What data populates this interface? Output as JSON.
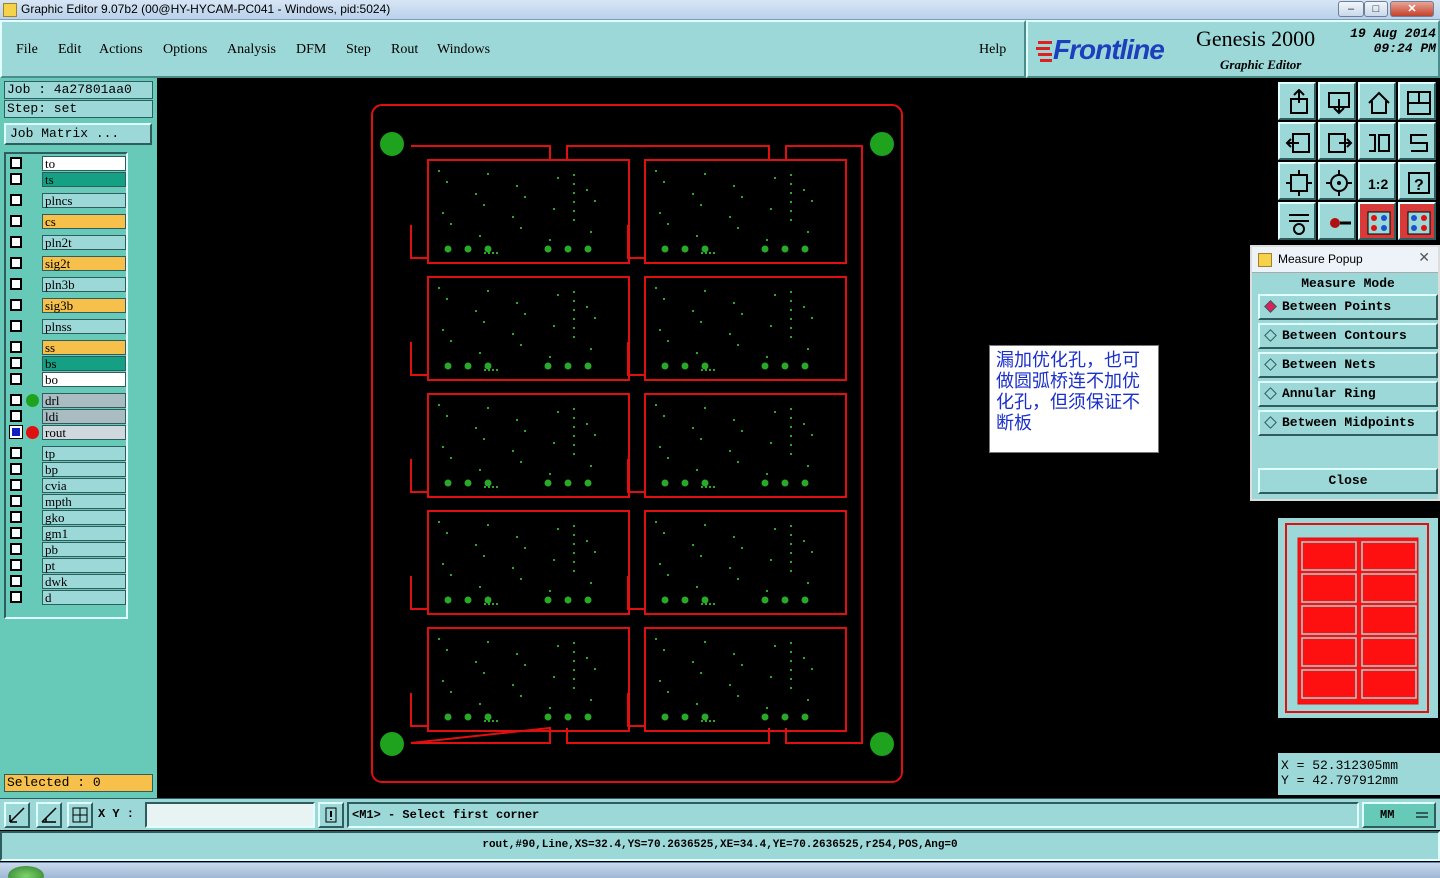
{
  "window": {
    "title": "Graphic Editor 9.07b2 (00@HY-HYCAM-PC041 - Windows, pid:5024)",
    "minimize": "–",
    "maximize": "□",
    "close": "✕"
  },
  "menu": [
    "File",
    "Edit",
    "Actions",
    "Options",
    "Analysis",
    "DFM",
    "Step",
    "Rout",
    "Windows"
  ],
  "help": "Help",
  "brand": {
    "logo": "Frontline",
    "product": "Genesis 2000",
    "subtitle": "Graphic Editor",
    "date": "19 Aug 2014",
    "time": "09:24 PM"
  },
  "job": {
    "job_line": "Job : 4a27801aa0",
    "step_line": "Step: set",
    "matrix_button": "Job Matrix ..."
  },
  "layers": [
    {
      "name": "to",
      "color": "#ffffff"
    },
    {
      "name": "ts",
      "color": "#16a083"
    },
    {
      "name": "plncs",
      "color": "#9cd8d8"
    },
    {
      "name": "cs",
      "color": "#f6c04a"
    },
    {
      "name": "pln2t",
      "color": "#9cd8d8"
    },
    {
      "name": "sig2t",
      "color": "#f6c04a"
    },
    {
      "name": "pln3b",
      "color": "#9cd8d8"
    },
    {
      "name": "sig3b",
      "color": "#f6c04a"
    },
    {
      "name": "plnss",
      "color": "#9cd8d8"
    },
    {
      "name": "ss",
      "color": "#f6c04a"
    },
    {
      "name": "bs",
      "color": "#16a083"
    },
    {
      "name": "bo",
      "color": "#ffffff"
    },
    {
      "name": "drl",
      "color": "#a9bcc2",
      "dot": "#1fa31f"
    },
    {
      "name": "ldi",
      "color": "#a9bcc2"
    },
    {
      "name": "rout",
      "color": "#cfd8dc",
      "dot": "#e01010",
      "active": true
    },
    {
      "name": "tp",
      "color": "#9cd8d8"
    },
    {
      "name": "bp",
      "color": "#9cd8d8"
    },
    {
      "name": "cvia",
      "color": "#9cd8d8"
    },
    {
      "name": "mpth",
      "color": "#9cd8d8"
    },
    {
      "name": "gko",
      "color": "#9cd8d8"
    },
    {
      "name": "gm1",
      "color": "#9cd8d8"
    },
    {
      "name": "pb",
      "color": "#9cd8d8"
    },
    {
      "name": "pt",
      "color": "#9cd8d8"
    },
    {
      "name": "dwk",
      "color": "#9cd8d8"
    },
    {
      "name": "d",
      "color": "#9cd8d8"
    }
  ],
  "selected": "Selected : 0",
  "note": "漏加优化孔，也可做圆弧桥连不加优化孔，但须保证不断板",
  "measure": {
    "title": "Measure Popup",
    "mode_label": "Measure Mode",
    "options": [
      "Between Points",
      "Between Contours",
      "Between Nets",
      "Annular Ring",
      "Between Midpoints"
    ],
    "selected_index": 0,
    "close": "Close"
  },
  "coords": {
    "x": "X = 52.312305mm",
    "y": "Y = 42.797912mm"
  },
  "bottom": {
    "xy_label": "X Y :",
    "xy_value": "",
    "prompt": "<M1> - Select first corner",
    "units": "MM"
  },
  "status_line": "rout,#90,Line,XS=32.4,YS=70.2636525,XE=34.4,YE=70.2636525,r254,POS,Ang=0",
  "colors": {
    "panel": "#9cd8d8",
    "panel_dark": "#67c9b8",
    "rout_outline": "#e01010",
    "fiducial": "#1fa31f",
    "pad": "#2aa82a"
  },
  "tools": [
    "open-icon",
    "save-icon",
    "home-icon",
    "window-icon",
    "left-icon",
    "right-icon",
    "flip-icon",
    "swap-icon",
    "fit-icon",
    "center-icon",
    "scale-icon",
    "help-icon",
    "settings-icon",
    "pin-icon",
    "layers-red-icon",
    "layers-red-icon-2"
  ]
}
